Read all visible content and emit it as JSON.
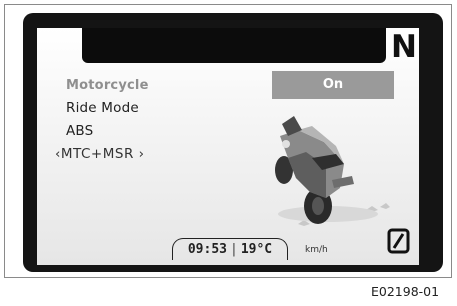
{
  "display": {
    "gear_indicator": "N",
    "menu": [
      {
        "label": "Motorcycle",
        "selected": true
      },
      {
        "label": "Ride Mode",
        "selected": false
      },
      {
        "label": "ABS",
        "selected": false
      },
      {
        "label": "‹MTC+MSR ›",
        "selected": false
      }
    ],
    "selected_value": "On",
    "status": {
      "time": "09:53",
      "temperature": "19°C",
      "speed_unit": "km/h"
    },
    "icons": [
      "motorcycle-icon",
      "power-icon"
    ]
  },
  "caption": "E02198-01"
}
